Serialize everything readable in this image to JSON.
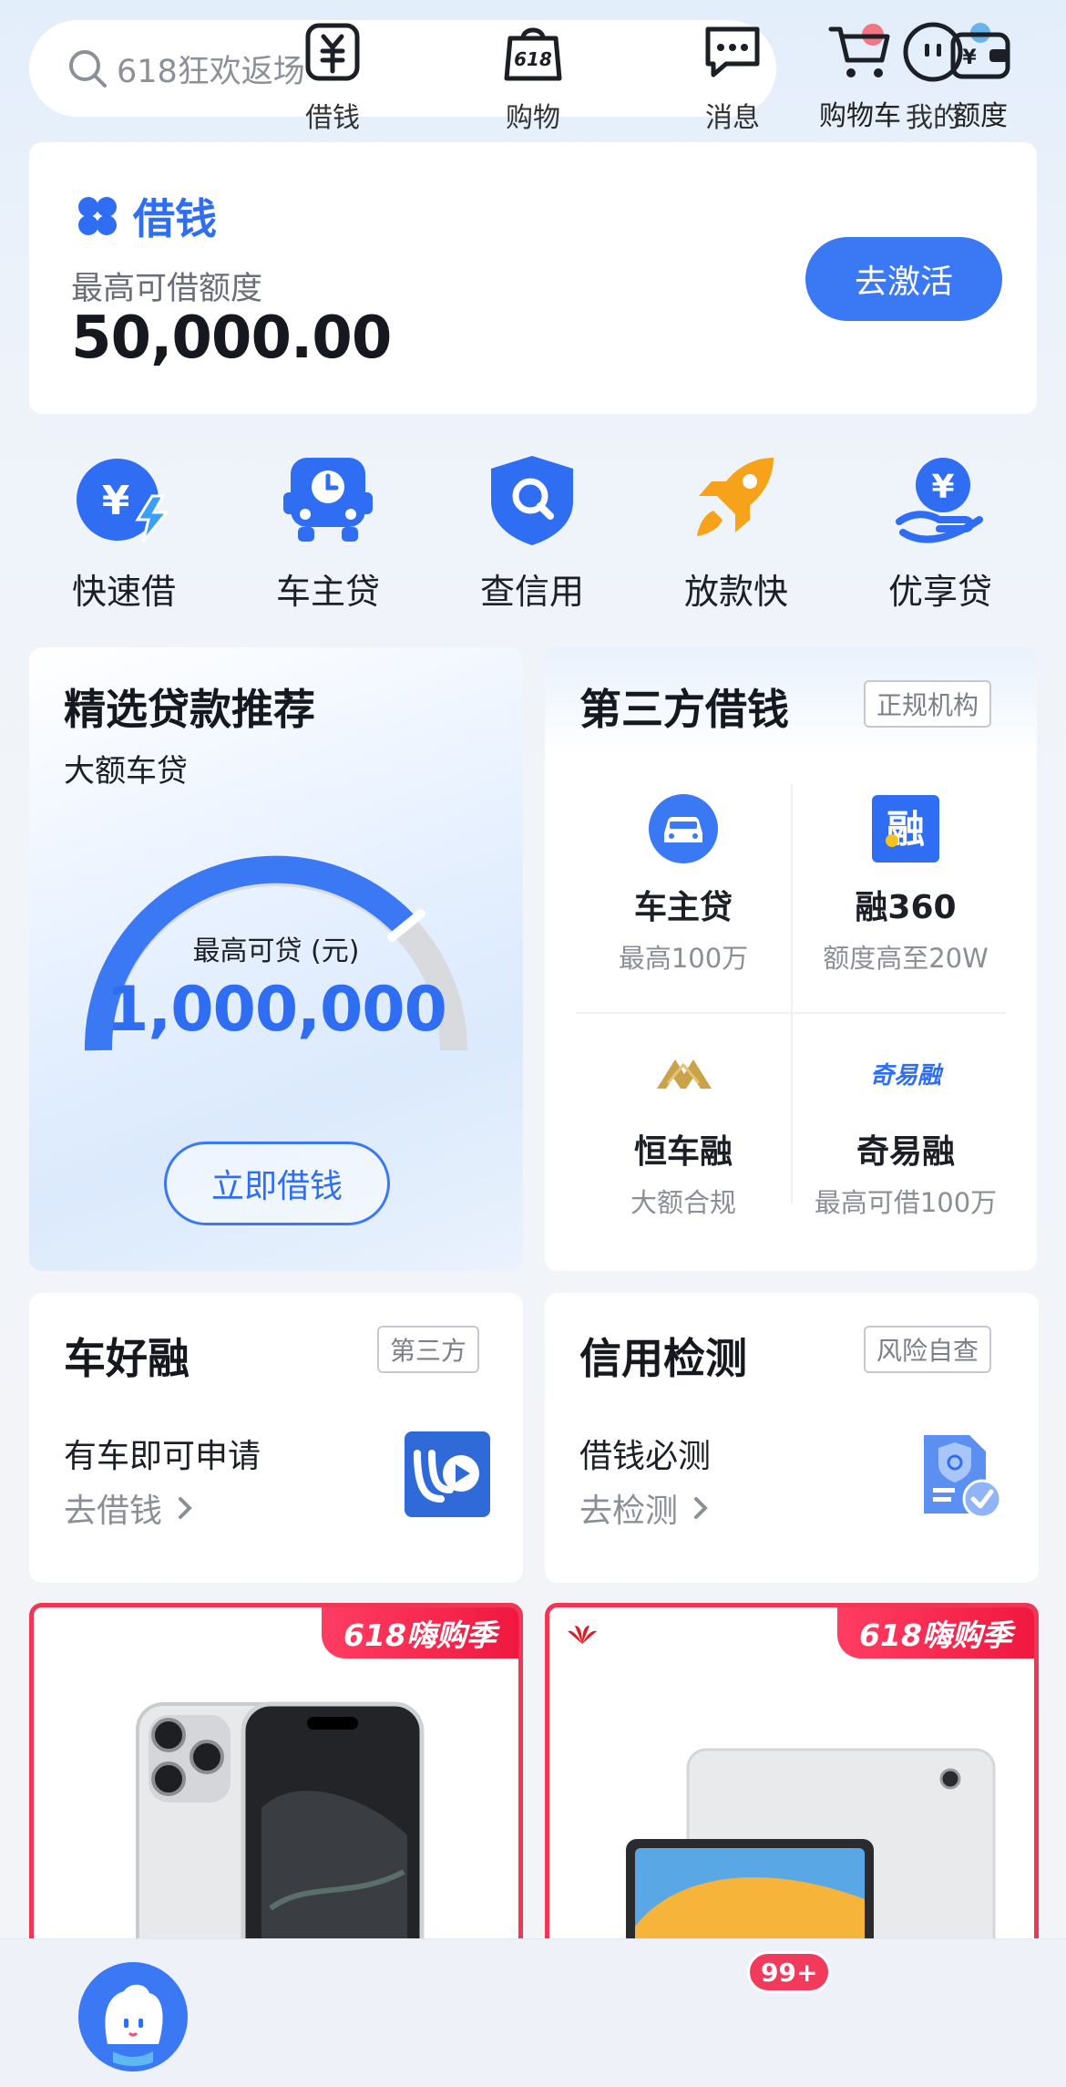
{
  "header": {
    "search_placeholder": "618狂欢返场",
    "cart_label": "购物车",
    "quota_label": "额度"
  },
  "borrow_card": {
    "title": "借钱",
    "subtitle": "最高可借额度",
    "amount": "50,000.00",
    "button": "去激活"
  },
  "quick_nav": [
    {
      "label": "快速借",
      "icon": "yen-lightning-icon"
    },
    {
      "label": "车主贷",
      "icon": "car-icon"
    },
    {
      "label": "查信用",
      "icon": "shield-search-icon"
    },
    {
      "label": "放款快",
      "icon": "rocket-icon"
    },
    {
      "label": "优享贷",
      "icon": "hand-coin-icon"
    }
  ],
  "recommend": {
    "title": "精选贷款推荐",
    "subtitle": "大额车贷",
    "gauge_label": "最高可贷 (元)",
    "gauge_value": "1,000,000",
    "button": "立即借钱"
  },
  "third_party": {
    "title": "第三方借钱",
    "tag": "正规机构",
    "items": [
      {
        "name": "车主贷",
        "desc": "最高100万"
      },
      {
        "name": "融360",
        "desc": "额度高至20W"
      },
      {
        "name": "恒车融",
        "desc": "大额合规"
      },
      {
        "name": "奇易融",
        "desc": "最高可借100万"
      }
    ],
    "logo_text_qiyirong": "奇易融",
    "logo_text_rong": "融"
  },
  "che_hao_rong": {
    "title": "车好融",
    "tag": "第三方",
    "line1": "有车即可申请",
    "line2": "去借钱"
  },
  "credit_check": {
    "title": "信用检测",
    "tag": "风险自查",
    "line1": "借钱必测",
    "line2": "去检测"
  },
  "promos": [
    {
      "badge": "618嗨购季"
    },
    {
      "badge": "618嗨购季"
    }
  ],
  "tabbar": {
    "tabs": [
      {
        "label": ""
      },
      {
        "label": "借钱"
      },
      {
        "label": "购物"
      },
      {
        "label": "消息"
      },
      {
        "label": "我的"
      }
    ],
    "message_badge": "99+",
    "shop_icon_text": "618"
  },
  "colors": {
    "accent": "#3a78f4",
    "promo_red": "#f03655",
    "orange": "#f7a21b"
  }
}
